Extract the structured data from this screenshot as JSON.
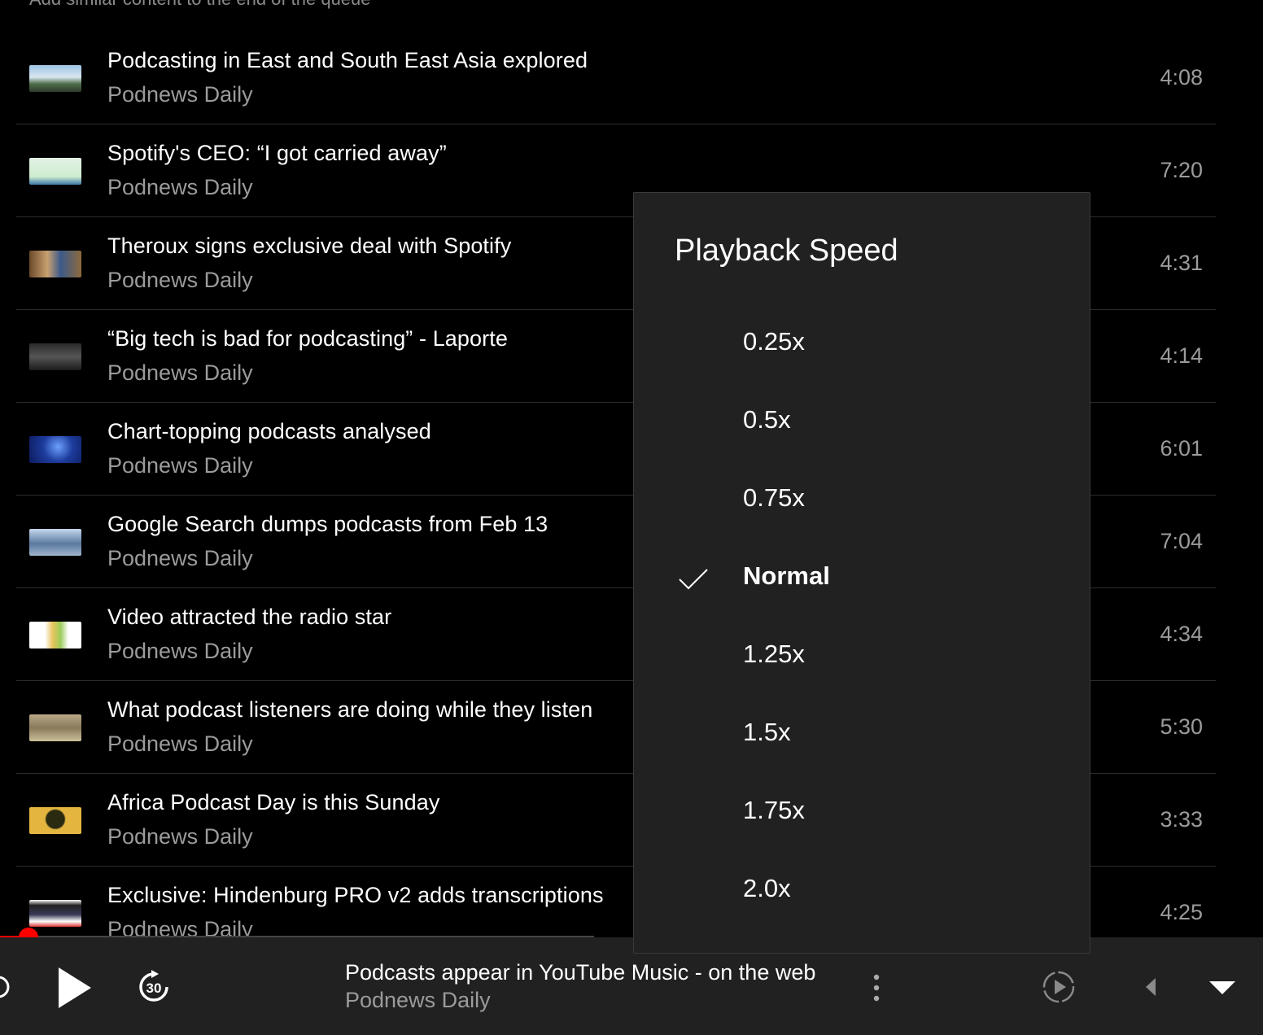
{
  "queue_header": "Add similar content to the end of the queue",
  "queue": [
    {
      "title": "Podcasting in East and South East Asia explored",
      "artist": "Podnews Daily",
      "duration": "4:08",
      "thumb": "city-photo"
    },
    {
      "title": "Spotify's CEO: “I got carried away”",
      "artist": "Podnews Daily",
      "duration": "7:20",
      "thumb": "green-slide"
    },
    {
      "title": "Theroux signs exclusive deal with Spotify",
      "artist": "Podnews Daily",
      "duration": "4:31",
      "thumb": "studio-photo"
    },
    {
      "title": "“Big tech is bad for podcasting” - Laporte",
      "artist": "Podnews Daily",
      "duration": "4:14",
      "thumb": "microphone-photo"
    },
    {
      "title": "Chart-topping podcasts analysed",
      "artist": "Podnews Daily",
      "duration": "6:01",
      "thumb": "network-graphic"
    },
    {
      "title": "Google Search dumps podcasts from Feb 13",
      "artist": "Podnews Daily",
      "duration": "7:04",
      "thumb": "google-building"
    },
    {
      "title": "Video attracted the radio star",
      "artist": "Podnews Daily",
      "duration": "4:34",
      "thumb": "fruit-photo"
    },
    {
      "title": "What podcast listeners are doing while they listen",
      "artist": "Podnews Daily",
      "duration": "5:30",
      "thumb": "kitchen-photo"
    },
    {
      "title": "Africa Podcast Day is this Sunday",
      "artist": "Podnews Daily",
      "duration": "3:33",
      "thumb": "africa-logo"
    },
    {
      "title": "Exclusive: Hindenburg PRO v2 adds transcriptions",
      "artist": "Podnews Daily",
      "duration": "4:25",
      "thumb": "software-screenshot"
    }
  ],
  "speed_menu": {
    "title": "Playback Speed",
    "options": [
      {
        "label": "0.25x",
        "selected": false
      },
      {
        "label": "0.5x",
        "selected": false
      },
      {
        "label": "0.75x",
        "selected": false
      },
      {
        "label": "Normal",
        "selected": true
      },
      {
        "label": "1.25x",
        "selected": false
      },
      {
        "label": "1.5x",
        "selected": false
      },
      {
        "label": "1.75x",
        "selected": false
      },
      {
        "label": "2.0x",
        "selected": false
      }
    ]
  },
  "player": {
    "title": "Podcasts appear in YouTube Music - on the web",
    "artist": "Podnews Daily",
    "skip_forward_label": "30",
    "progress_fraction": 0.02,
    "colors": {
      "progress": "#ff0000",
      "bar_bg": "#212121"
    },
    "icons": [
      "replay-icon",
      "play-icon",
      "forward-30-icon",
      "more-vert-icon",
      "autoplay-icon",
      "prev-icon",
      "collapse-icon"
    ]
  }
}
